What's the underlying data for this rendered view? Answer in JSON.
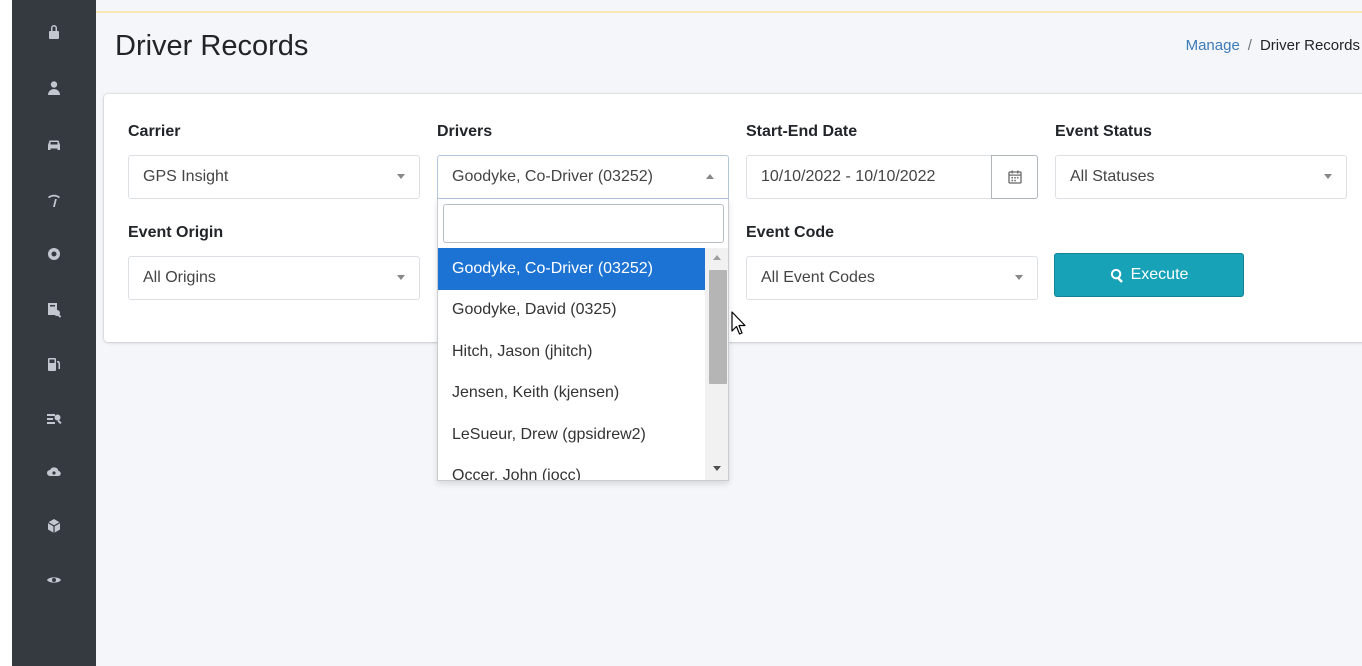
{
  "page": {
    "title": "Driver Records"
  },
  "breadcrumb": {
    "link": "Manage",
    "separator": "/",
    "current": "Driver Records"
  },
  "sidebar": {
    "icons": [
      "lock-icon",
      "user-icon",
      "car-icon",
      "signal-icon",
      "gear-icon",
      "report-icon",
      "fuel-icon",
      "search-list-icon",
      "cloud-icon",
      "cube-icon",
      "eye-icon"
    ]
  },
  "filters": {
    "carrier": {
      "label": "Carrier",
      "value": "GPS Insight"
    },
    "drivers": {
      "label": "Drivers",
      "value": "Goodyke, Co-Driver (03252)"
    },
    "date": {
      "label": "Start-End Date",
      "value": "10/10/2022 - 10/10/2022"
    },
    "event_status": {
      "label": "Event Status",
      "value": "All Statuses"
    },
    "event_origin": {
      "label": "Event Origin",
      "value": "All Origins"
    },
    "event_code": {
      "label": "Event Code",
      "value": "All Event Codes"
    }
  },
  "execute": {
    "label": "Execute"
  },
  "driver_dropdown": {
    "search_value": "",
    "options": [
      "Goodyke, Co-Driver (03252)",
      "Goodyke, David (0325)",
      "Hitch, Jason (jhitch)",
      "Jensen, Keith (kjensen)",
      "LeSueur, Drew (gpsidrew2)",
      "Occer, John (jocc)"
    ],
    "selected_index": 0
  },
  "colors": {
    "sidebar_bg": "#343a40",
    "accent": "#17a2b8",
    "link": "#3d7ab8",
    "selected_option": "#1d73d3"
  }
}
